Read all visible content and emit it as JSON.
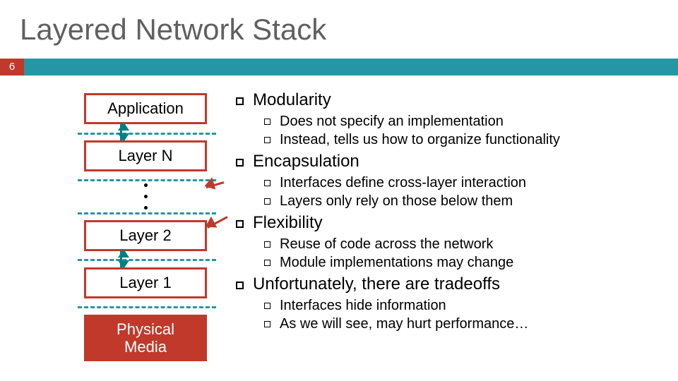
{
  "title": "Layered Network Stack",
  "page_number": "6",
  "layers": {
    "application": "Application",
    "n": "Layer N",
    "two": "Layer 2",
    "one": "Layer 1",
    "physical": "Physical\nMedia"
  },
  "bullets": {
    "b1": "Modularity",
    "b1a": "Does not specify an implementation",
    "b1b": "Instead, tells us how to organize functionality",
    "b2": "Encapsulation",
    "b2a": "Interfaces define cross-layer interaction",
    "b2b": "Layers only rely on those below them",
    "b3": "Flexibility",
    "b3a": "Reuse of code across the network",
    "b3b": "Module implementations may change",
    "b4": "Unfortunately, there are tradeoffs",
    "b4a": "Interfaces hide information",
    "b4b": "As we will see, may hurt performance…"
  }
}
